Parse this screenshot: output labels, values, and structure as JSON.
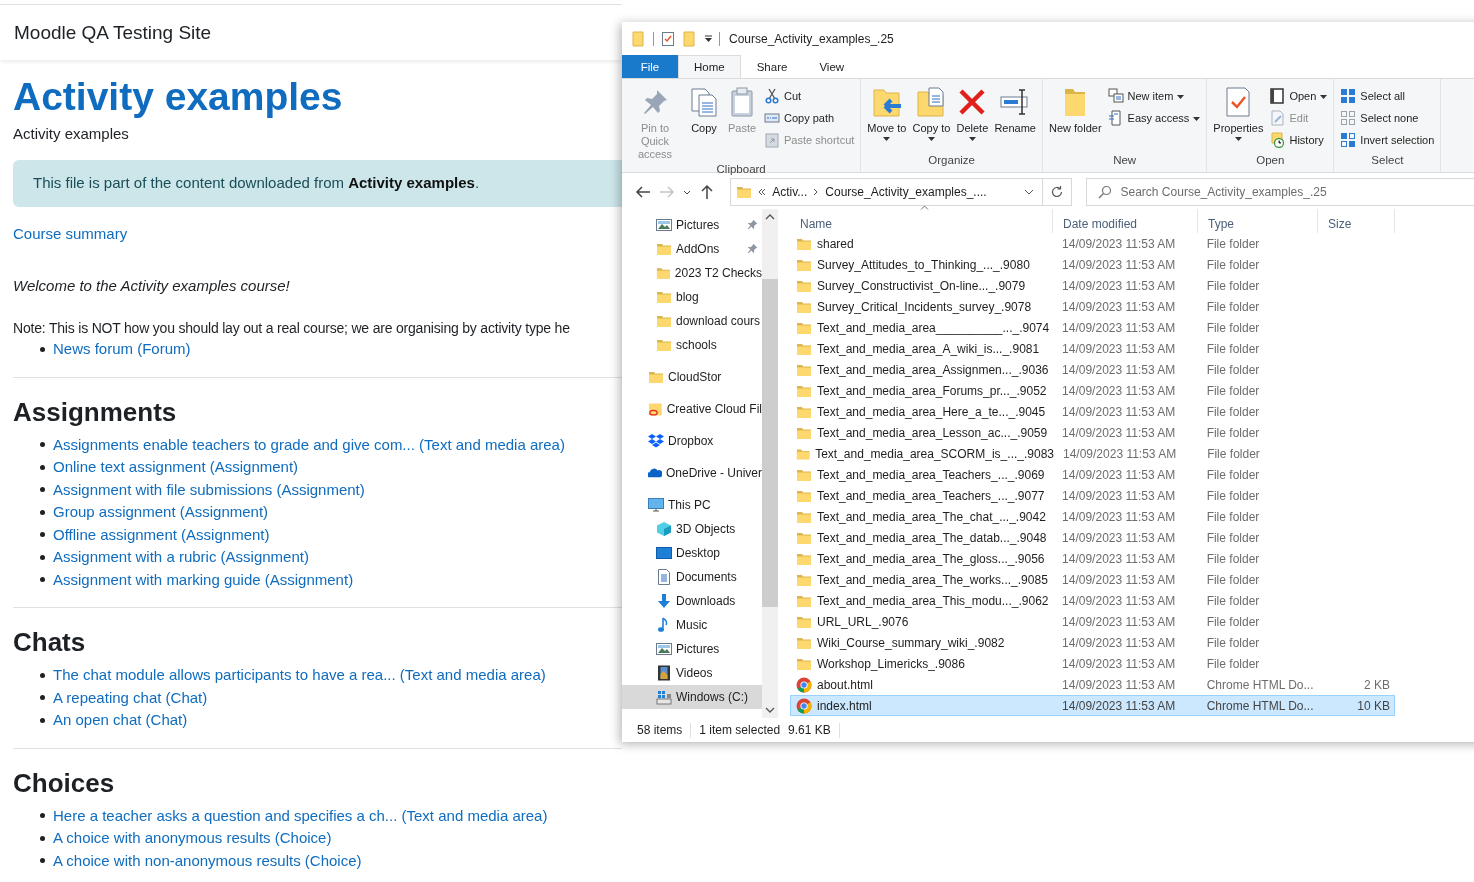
{
  "browser_page": {
    "site_name": "Moodle QA Testing Site",
    "heading": "Activity examples",
    "subtitle": "Activity examples",
    "notice": "This file is part of the content downloaded from **Activity examples**.",
    "summary_link": "Course summary",
    "welcome": "Welcome to the Activity examples course!",
    "note": "Note: This is NOT how you should lay out a real course; we are organising by activity type he",
    "intro_links": [
      "News forum (Forum)"
    ],
    "sections": [
      {
        "title": "Assignments",
        "links": [
          "Assignments enable teachers to grade and give com... (Text and media area)",
          "Online text assignment (Assignment)",
          "Assignment with file submissions (Assignment)",
          "Group assignment (Assignment)",
          "Offline assignment (Assignment)",
          "Assignment with a rubric (Assignment)",
          "Assignment with marking guide (Assignment)"
        ]
      },
      {
        "title": "Chats",
        "links": [
          "The chat module allows participants to have a rea... (Text and media area)",
          "A repeating chat (Chat)",
          "An open chat (Chat)"
        ]
      },
      {
        "title": "Choices",
        "links": [
          "Here a teacher asks a question and specifies a ch... (Text and media area)",
          "A choice with anonymous results (Choice)",
          "A choice with non-anonymous results (Choice)"
        ]
      }
    ]
  },
  "explorer": {
    "title": "Course_Activity_examples_.25",
    "ribbon_tabs": [
      {
        "label": "File",
        "kind": "menu",
        "selected": false
      },
      {
        "label": "Home",
        "kind": "tab",
        "selected": true
      },
      {
        "label": "Share",
        "kind": "tab",
        "selected": false
      },
      {
        "label": "View",
        "kind": "tab",
        "selected": false
      }
    ],
    "ribbon_groups": [
      {
        "label": "Clipboard",
        "large": [
          {
            "label": "Pin to Quick access",
            "kind": "pin",
            "disabled": true,
            "dropdown": false
          },
          {
            "label": "Copy",
            "kind": "copy",
            "disabled": false,
            "dropdown": false
          },
          {
            "label": "Paste",
            "kind": "paste",
            "disabled": true,
            "dropdown": false
          }
        ],
        "small": [
          {
            "label": "Cut",
            "kind": "cut",
            "disabled": false,
            "dropdown": false
          },
          {
            "label": "Copy path",
            "kind": "copy-path",
            "disabled": false,
            "dropdown": false
          },
          {
            "label": "Paste shortcut",
            "kind": "paste-shortcut",
            "disabled": true,
            "dropdown": false
          }
        ]
      },
      {
        "label": "Organize",
        "large": [
          {
            "label": "Move to",
            "kind": "move",
            "disabled": false,
            "dropdown": true
          },
          {
            "label": "Copy to",
            "kind": "copy-to",
            "disabled": false,
            "dropdown": true
          },
          {
            "label": "Delete",
            "kind": "delete",
            "disabled": false,
            "dropdown": true
          },
          {
            "label": "Rename",
            "kind": "rename",
            "disabled": false,
            "dropdown": false
          }
        ]
      },
      {
        "label": "New",
        "large": [
          {
            "label": "New folder",
            "kind": "new-folder",
            "disabled": false,
            "dropdown": false
          }
        ],
        "small": [
          {
            "label": "New item",
            "kind": "new-item",
            "disabled": false,
            "dropdown": true
          },
          {
            "label": "Easy access",
            "kind": "easy-access",
            "disabled": false,
            "dropdown": true
          }
        ]
      },
      {
        "label": "Open",
        "large": [
          {
            "label": "Properties",
            "kind": "properties",
            "disabled": false,
            "dropdown": true
          }
        ],
        "small": [
          {
            "label": "Open",
            "kind": "open",
            "disabled": false,
            "dropdown": true
          },
          {
            "label": "Edit",
            "kind": "edit",
            "disabled": true,
            "dropdown": false
          },
          {
            "label": "History",
            "kind": "history",
            "disabled": false,
            "dropdown": false
          }
        ]
      },
      {
        "label": "Select",
        "small": [
          {
            "label": "Select all",
            "kind": "select-all",
            "disabled": false,
            "dropdown": false
          },
          {
            "label": "Select none",
            "kind": "select-none",
            "disabled": false,
            "dropdown": false
          },
          {
            "label": "Invert selection",
            "kind": "invert-selection",
            "disabled": false,
            "dropdown": false
          }
        ]
      }
    ],
    "nav_buttons": [
      {
        "kind": "back",
        "disabled": false
      },
      {
        "kind": "forward",
        "disabled": true
      },
      {
        "kind": "recent",
        "disabled": false
      },
      {
        "kind": "up",
        "disabled": false
      }
    ],
    "breadcrumbs": [
      "Activ...",
      "Course_Activity_examples_...."
    ],
    "search": {
      "placeholder": "Search Course_Activity_examples_.25"
    },
    "nav_pane": {
      "quick_access": [
        {
          "label": "Pictures",
          "kind": "pictures",
          "pinned": true,
          "selected": false
        },
        {
          "label": "AddOns",
          "kind": "folder",
          "pinned": true,
          "selected": false
        },
        {
          "label": "2023 T2 Checks",
          "kind": "folder",
          "pinned": false,
          "selected": false
        },
        {
          "label": "blog",
          "kind": "folder",
          "pinned": false,
          "selected": false
        },
        {
          "label": "download cours",
          "kind": "folder",
          "pinned": false,
          "selected": false
        },
        {
          "label": "schools",
          "kind": "folder",
          "pinned": false,
          "selected": false
        }
      ],
      "locations": [
        {
          "label": "CloudStor",
          "kind": "folder",
          "selected": false
        },
        {
          "label": "Creative Cloud Fil",
          "kind": "creative-cloud",
          "selected": false
        },
        {
          "label": "Dropbox",
          "kind": "dropbox",
          "selected": false
        },
        {
          "label": "OneDrive - Univer",
          "kind": "onedrive",
          "selected": false
        },
        {
          "label": "This PC",
          "kind": "pc",
          "selected": false,
          "children": [
            {
              "label": "3D Objects",
              "kind": "cube",
              "selected": false
            },
            {
              "label": "Desktop",
              "kind": "desktop",
              "selected": false
            },
            {
              "label": "Documents",
              "kind": "documents",
              "selected": false
            },
            {
              "label": "Downloads",
              "kind": "downloads",
              "selected": false
            },
            {
              "label": "Music",
              "kind": "music",
              "selected": false
            },
            {
              "label": "Pictures",
              "kind": "pictures",
              "selected": false
            },
            {
              "label": "Videos",
              "kind": "videos",
              "selected": false
            },
            {
              "label": "Windows (C:)",
              "kind": "drive",
              "selected": true
            }
          ]
        }
      ]
    },
    "columns": [
      {
        "label": "Name",
        "sorted": true
      },
      {
        "label": "Date modified",
        "sorted": false
      },
      {
        "label": "Type",
        "sorted": false
      },
      {
        "label": "Size",
        "sorted": false
      }
    ],
    "files": [
      {
        "name": "shared",
        "date": "14/09/2023 11:53 AM",
        "type": "File folder",
        "kind": "folder",
        "selected": false
      },
      {
        "name": "Survey_Attitudes_to_Thinking_..._.9080",
        "date": "14/09/2023 11:53 AM",
        "type": "File folder",
        "kind": "folder",
        "selected": false
      },
      {
        "name": "Survey_Constructivist_On-line..._.9079",
        "date": "14/09/2023 11:53 AM",
        "type": "File folder",
        "kind": "folder",
        "selected": false
      },
      {
        "name": "Survey_Critical_Incidents_survey_.9078",
        "date": "14/09/2023 11:53 AM",
        "type": "File folder",
        "kind": "folder",
        "selected": false
      },
      {
        "name": "Text_and_media_area__________..._.9074",
        "date": "14/09/2023 11:53 AM",
        "type": "File folder",
        "kind": "folder",
        "selected": false
      },
      {
        "name": "Text_and_media_area_A_wiki_is..._.9081",
        "date": "14/09/2023 11:53 AM",
        "type": "File folder",
        "kind": "folder",
        "selected": false
      },
      {
        "name": "Text_and_media_area_Assignmen..._.9036",
        "date": "14/09/2023 11:53 AM",
        "type": "File folder",
        "kind": "folder",
        "selected": false
      },
      {
        "name": "Text_and_media_area_Forums_pr..._.9052",
        "date": "14/09/2023 11:53 AM",
        "type": "File folder",
        "kind": "folder",
        "selected": false
      },
      {
        "name": "Text_and_media_area_Here_a_te..._.9045",
        "date": "14/09/2023 11:53 AM",
        "type": "File folder",
        "kind": "folder",
        "selected": false
      },
      {
        "name": "Text_and_media_area_Lesson_ac..._.9059",
        "date": "14/09/2023 11:53 AM",
        "type": "File folder",
        "kind": "folder",
        "selected": false
      },
      {
        "name": "Text_and_media_area_SCORM_is_..._.9083",
        "date": "14/09/2023 11:53 AM",
        "type": "File folder",
        "kind": "folder",
        "selected": false
      },
      {
        "name": "Text_and_media_area_Teachers_..._.9069",
        "date": "14/09/2023 11:53 AM",
        "type": "File folder",
        "kind": "folder",
        "selected": false
      },
      {
        "name": "Text_and_media_area_Teachers_..._.9077",
        "date": "14/09/2023 11:53 AM",
        "type": "File folder",
        "kind": "folder",
        "selected": false
      },
      {
        "name": "Text_and_media_area_The_chat_..._.9042",
        "date": "14/09/2023 11:53 AM",
        "type": "File folder",
        "kind": "folder",
        "selected": false
      },
      {
        "name": "Text_and_media_area_The_datab..._.9048",
        "date": "14/09/2023 11:53 AM",
        "type": "File folder",
        "kind": "folder",
        "selected": false
      },
      {
        "name": "Text_and_media_area_The_gloss..._.9056",
        "date": "14/09/2023 11:53 AM",
        "type": "File folder",
        "kind": "folder",
        "selected": false
      },
      {
        "name": "Text_and_media_area_The_works..._.9085",
        "date": "14/09/2023 11:53 AM",
        "type": "File folder",
        "kind": "folder",
        "selected": false
      },
      {
        "name": "Text_and_media_area_This_modu..._.9062",
        "date": "14/09/2023 11:53 AM",
        "type": "File folder",
        "kind": "folder",
        "selected": false
      },
      {
        "name": "URL_URL_.9076",
        "date": "14/09/2023 11:53 AM",
        "type": "File folder",
        "kind": "folder",
        "selected": false
      },
      {
        "name": "Wiki_Course_summary_wiki_.9082",
        "date": "14/09/2023 11:53 AM",
        "type": "File folder",
        "kind": "folder",
        "selected": false
      },
      {
        "name": "Workshop_Limericks_.9086",
        "date": "14/09/2023 11:53 AM",
        "type": "File folder",
        "kind": "folder",
        "selected": false
      },
      {
        "name": "about.html",
        "date": "14/09/2023 11:53 AM",
        "type": "Chrome HTML Do...",
        "size": "2 KB",
        "kind": "html",
        "selected": false
      },
      {
        "name": "index.html",
        "date": "14/09/2023 11:53 AM",
        "type": "Chrome HTML Do...",
        "size": "10 KB",
        "kind": "html",
        "selected": true
      }
    ],
    "status_bar": {
      "item_count": "58 items",
      "selection": "1 item selected",
      "selection_size": "9.61 KB"
    }
  }
}
